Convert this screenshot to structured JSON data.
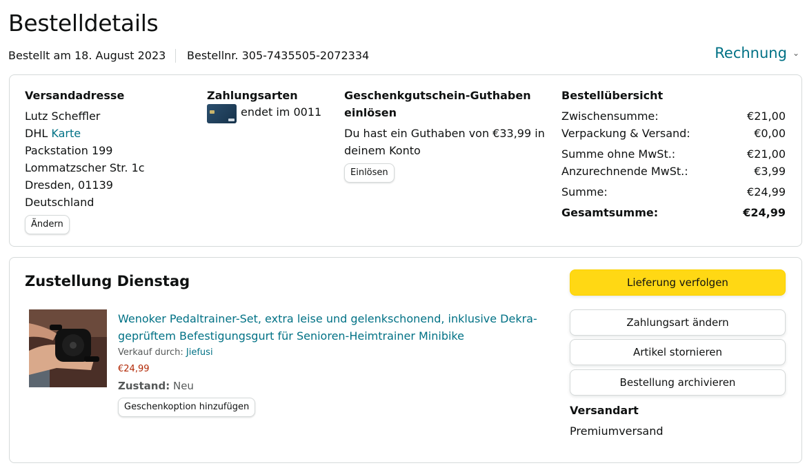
{
  "page": {
    "title": "Bestelldetails",
    "ordered_on": "Bestellt am 18. August 2023",
    "order_number": "Bestellnr. 305-7435505-2072334",
    "invoice_label": "Rechnung"
  },
  "address": {
    "header": "Versandadresse",
    "name": "Lutz Scheffler",
    "carrier": "DHL",
    "map_link": "Karte",
    "line1": "Packstation 199",
    "line2": "Lommatzscher Str. 1c",
    "city": "Dresden, 01139",
    "country": "Deutschland",
    "change_button": "Ändern"
  },
  "payment": {
    "header": "Zahlungsarten",
    "card_text": "endet im 0011"
  },
  "giftcard": {
    "header_line1": "Geschenkgutschein-Guthaben",
    "header_line2": "einlösen",
    "text_line1": "Du hast ein Guthaben von €33,99 in",
    "text_line2": "deinem Konto",
    "redeem_button": "Einlösen"
  },
  "summary": {
    "header": "Bestellübersicht",
    "rows": [
      {
        "label": "Zwischensumme:",
        "value": "€21,00"
      },
      {
        "label": "Verpackung & Versand:",
        "value": "€0,00"
      },
      {
        "label": "Summe ohne MwSt.:",
        "value": "€21,00"
      },
      {
        "label": "Anzurechnende MwSt.:",
        "value": "€3,99"
      },
      {
        "label": "Summe:",
        "value": "€24,99"
      },
      {
        "label": "Gesamtsumme:",
        "value": "€24,99"
      }
    ]
  },
  "shipment": {
    "header": "Zustellung Dienstag",
    "product_title_line1": "Wenoker Pedaltrainer-Set, extra leise und gelenkschonend, inklusive Dekra-",
    "product_title_line2": "geprüftem Befestigungsgurt für Senioren-Heimtrainer Minibike",
    "sold_by_label": "Verkauf durch:",
    "seller": "Jiefusi",
    "price": "€24,99",
    "condition_label": "Zustand:",
    "condition_value": "Neu",
    "gift_button": "Geschenkoption hinzufügen",
    "actions": {
      "track": "Lieferung verfolgen",
      "change_payment": "Zahlungsart ändern",
      "cancel": "Artikel stornieren",
      "archive": "Bestellung archivieren"
    },
    "shipping_type_header": "Versandart",
    "shipping_type_value": "Premiumversand"
  },
  "colors": {
    "link": "#007185",
    "primary_button": "#ffd814",
    "price": "#b12704"
  }
}
